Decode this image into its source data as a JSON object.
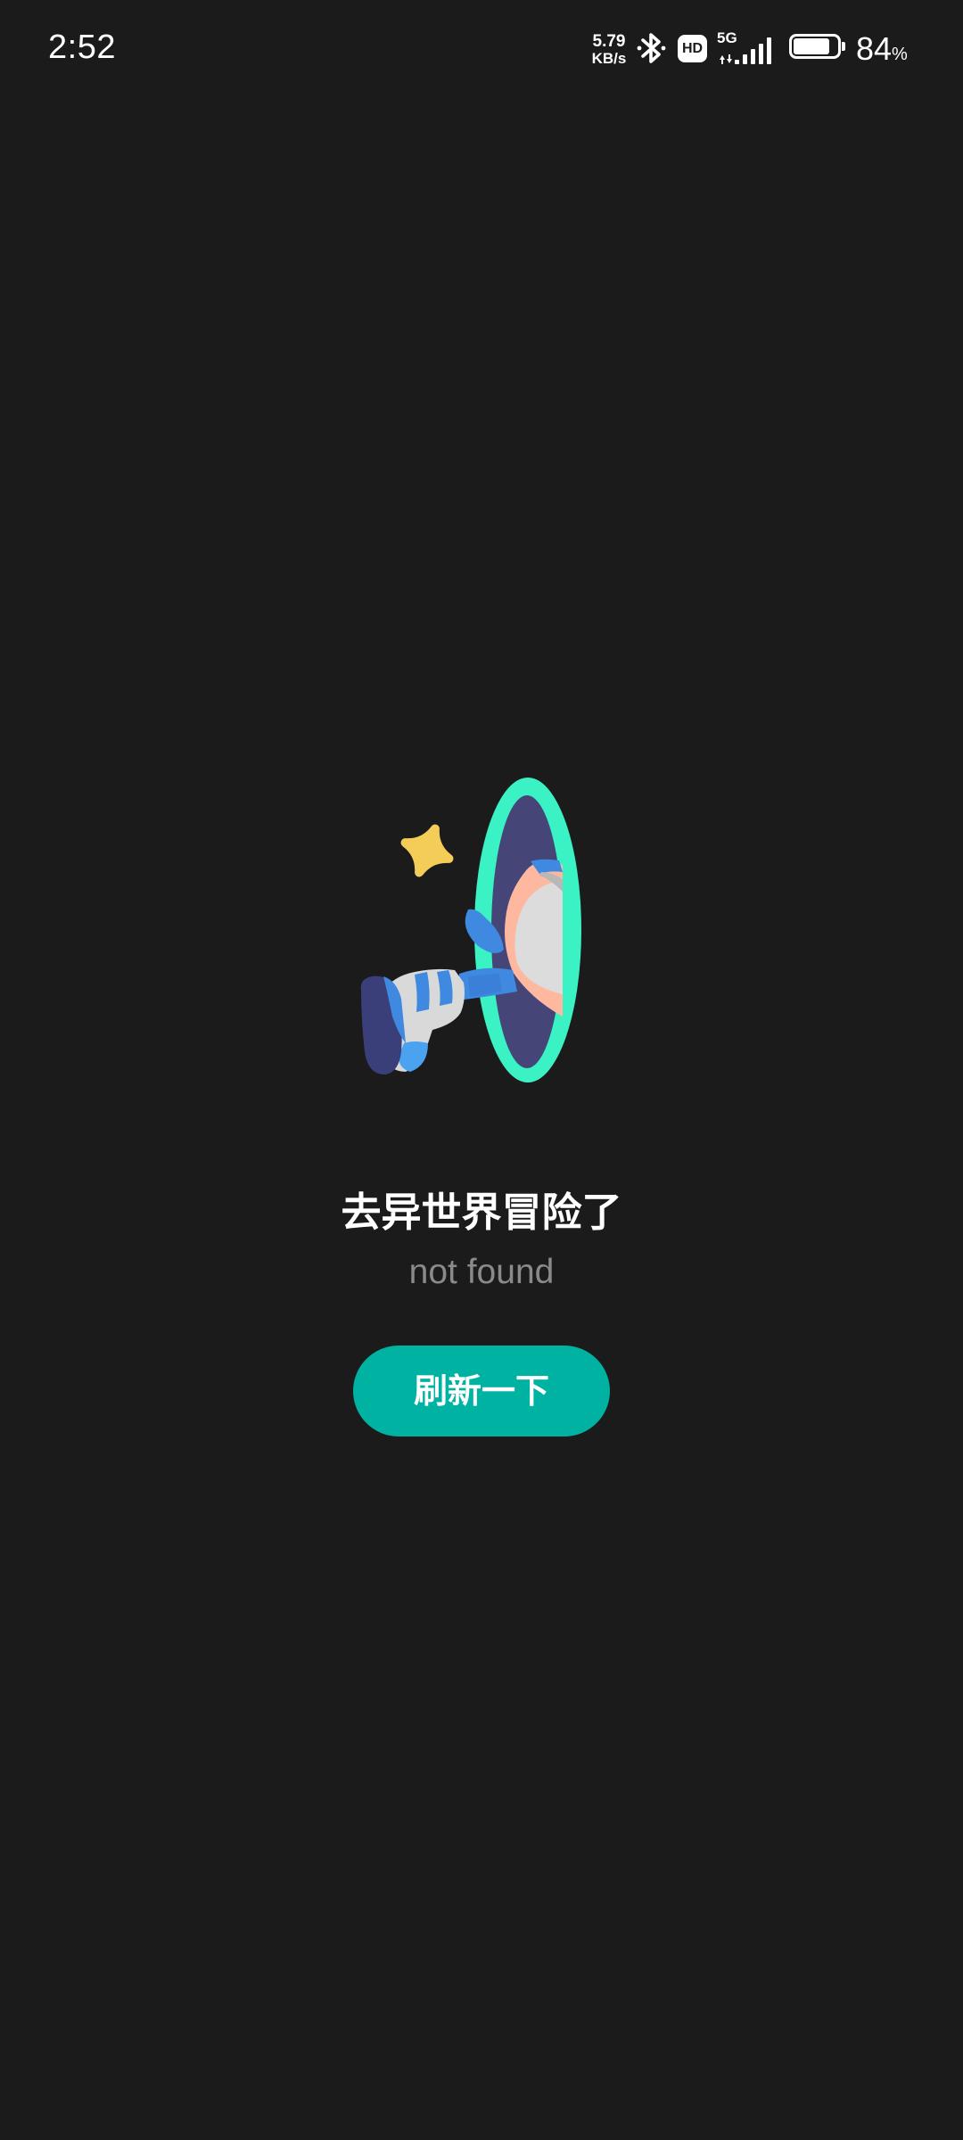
{
  "status_bar": {
    "time": "2:52",
    "net_speed_value": "5.79",
    "net_speed_unit": "KB/s",
    "hd_label": "HD",
    "network_type": "5G",
    "battery_level": 84,
    "battery_value": "84",
    "battery_unit": "%",
    "icons": [
      "bluetooth-icon",
      "hd-voice-icon",
      "cellular-signal-icon",
      "battery-icon"
    ]
  },
  "main": {
    "illustration": "portal-legs-illustration",
    "title": "去异世界冒险了",
    "subtitle": "not found",
    "refresh_label": "刷新一下"
  },
  "colors": {
    "background": "#1b1b1b",
    "accent_button": "#00b2a1",
    "portal_ring": "#3bf2c4",
    "portal_inner": "#454578",
    "subtitle_text": "#8a8a8a"
  }
}
